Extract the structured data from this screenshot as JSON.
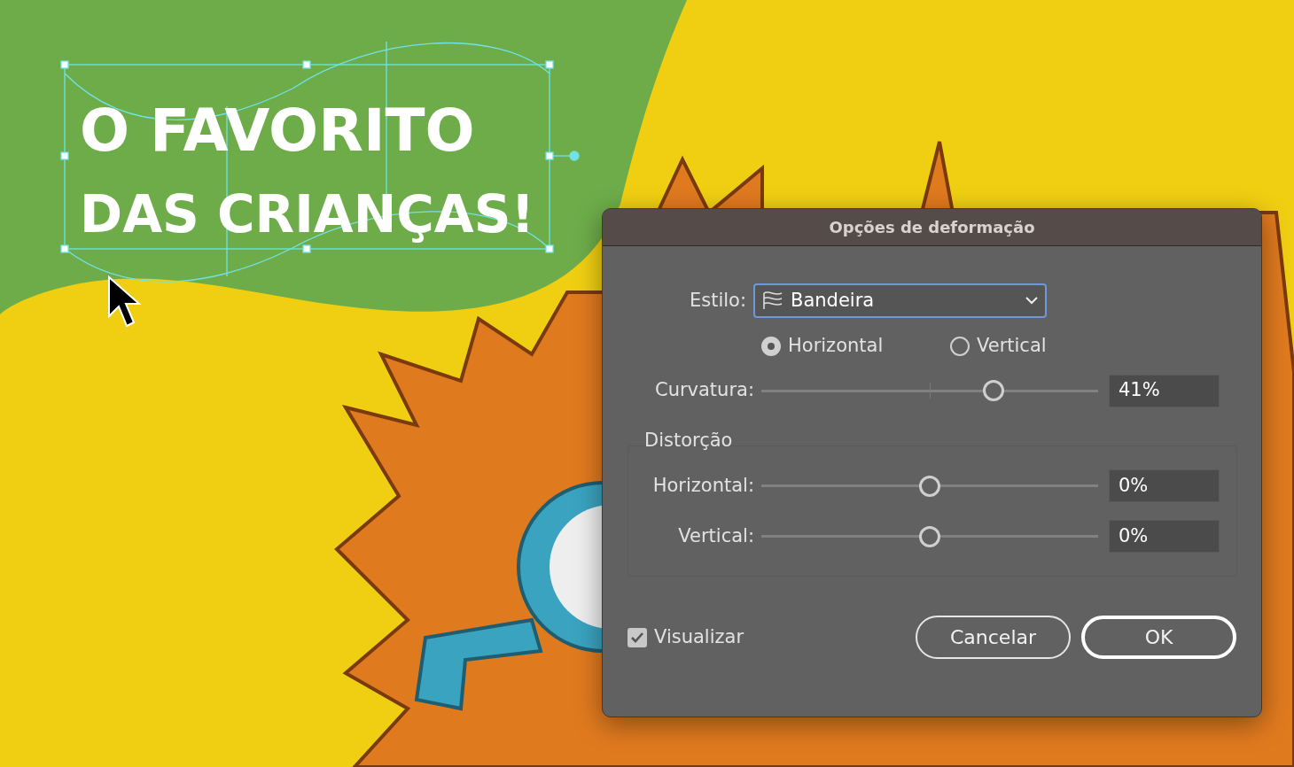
{
  "artboard": {
    "headline_lines": [
      "O FAVORITO",
      "DAS CRIANÇAS!"
    ]
  },
  "dialog": {
    "title": "Opções de deformação",
    "style_field": {
      "label": "Estilo:",
      "value": "Bandeira"
    },
    "orientation": [
      {
        "label": "Horizontal",
        "selected": true
      },
      {
        "label": "Vertical",
        "selected": false
      }
    ],
    "bend": {
      "label": "Curvatura:",
      "level": 0.69,
      "reading": "41%"
    },
    "distortion": {
      "title": "Distorção",
      "sliders": [
        {
          "label": "Horizontal:",
          "level": 0.5,
          "reading": "0%"
        },
        {
          "label": "Vertical:",
          "level": 0.5,
          "reading": "0%"
        }
      ]
    },
    "preview": {
      "label": "Visualizar",
      "checked": true
    },
    "buttons": [
      {
        "label": "Cancelar",
        "kind": "secondary"
      },
      {
        "label": "OK",
        "kind": "default"
      }
    ]
  }
}
